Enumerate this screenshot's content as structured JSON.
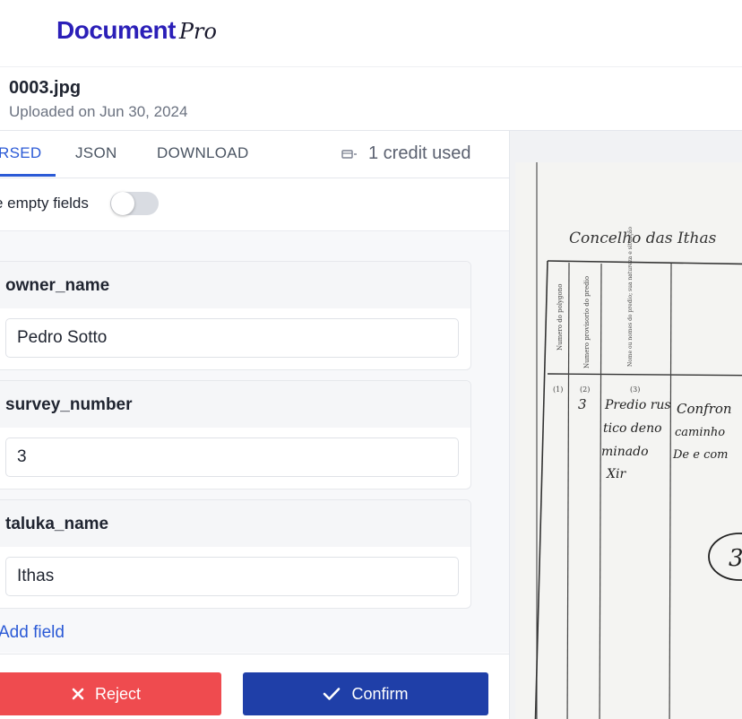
{
  "brand": {
    "name": "Document",
    "suffix": "Pro"
  },
  "file": {
    "name": "0003.jpg",
    "uploaded": "Uploaded on Jun 30, 2024"
  },
  "tabs": [
    {
      "label": "RSED",
      "active": true
    },
    {
      "label": "JSON",
      "active": false
    },
    {
      "label": "DOWNLOAD",
      "active": false
    }
  ],
  "credits": {
    "label": "1 credit used",
    "icon": "credit-icon"
  },
  "toggle": {
    "label": "e empty fields",
    "on": false
  },
  "fields": [
    {
      "key": "owner_name",
      "value": "Pedro Sotto"
    },
    {
      "key": "survey_number",
      "value": "3"
    },
    {
      "key": "taluka_name",
      "value": "Ithas"
    }
  ],
  "add_field_label": "Add field",
  "actions": {
    "reject_label": "Reject",
    "confirm_label": "Confirm"
  },
  "document_preview": {
    "heading": "Concelho das Ithas",
    "column_headers": [
      "Numero do polygono",
      "Numero provisorio do predio",
      "Nome ou nomes do predio; sua natureza e situação"
    ],
    "column_numbers": [
      "(1)",
      "(2)",
      "(3)"
    ],
    "row_number": "3",
    "row_text": [
      "Predio rus",
      "tico deno",
      "minado",
      "Xir"
    ],
    "row_text2": [
      "Confron",
      "caminho",
      "De e com"
    ],
    "circle_label": "3"
  },
  "colors": {
    "accent": "#2b5ad6",
    "brand": "#2b1fb8",
    "reject": "#ef4b4f",
    "confirm": "#1f3fa8"
  }
}
